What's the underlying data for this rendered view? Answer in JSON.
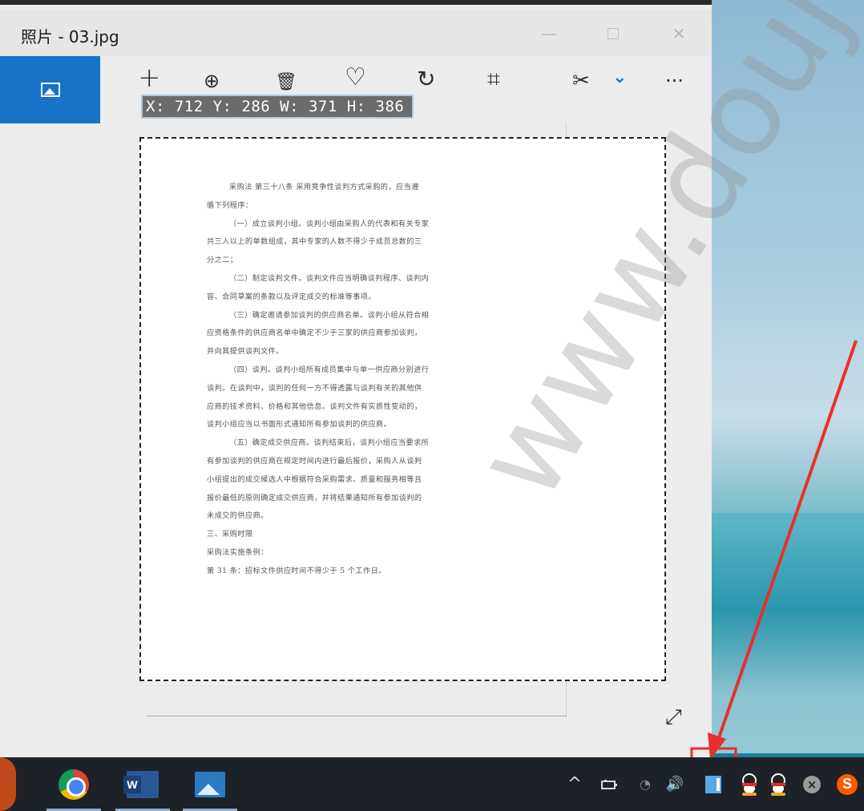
{
  "window": {
    "title": "照片 - 03.jpg",
    "controls": {
      "minimize": "—",
      "close": "✕"
    }
  },
  "toolbar": {
    "add": "+",
    "zoom": "⊕",
    "delete": "🗑",
    "favorite": "♡",
    "rotate": "↻",
    "crop": "⌗",
    "edit": "✂",
    "edit_dropdown": "⌄",
    "more": "···"
  },
  "selection_readout": "X: 712 Y: 286 W: 371 H: 386",
  "document": {
    "lines": [
      {
        "text": "采购法  第三十八条  采用竞争性谈判方式采购的，应当遵",
        "indent": true
      },
      {
        "text": "循下列程序：",
        "indent": false
      },
      {
        "text": "（一）成立谈判小组。谈判小组由采购人的代表和有关专家",
        "indent": true
      },
      {
        "text": "共三人以上的单数组成，其中专家的人数不得少于成员总数的三",
        "indent": false
      },
      {
        "text": "分之二；",
        "indent": false
      },
      {
        "text": "（二）制定谈判文件。谈判文件应当明确谈判程序、谈判内",
        "indent": true
      },
      {
        "text": "容、合同草案的条款以及评定成交的标准等事项。",
        "indent": false
      },
      {
        "text": "（三）确定邀请参加谈判的供应商名单。谈判小组从符合相",
        "indent": true
      },
      {
        "text": "应资格条件的供应商名单中确定不少于三家的供应商参加谈判，",
        "indent": false
      },
      {
        "text": "并向其提供谈判文件。",
        "indent": false
      },
      {
        "text": "（四）谈判。谈判小组所有成员集中与单一供应商分别进行",
        "indent": true
      },
      {
        "text": "谈判。在谈判中，谈判的任何一方不得透露与谈判有关的其他供",
        "indent": false
      },
      {
        "text": "应商的技术资料、价格和其他信息。谈判文件有实质性变动的，",
        "indent": false
      },
      {
        "text": "谈判小组应当以书面形式通知所有参加谈判的供应商。",
        "indent": false
      },
      {
        "text": "（五）确定成交供应商。谈判结束后，谈判小组应当要求所",
        "indent": true
      },
      {
        "text": "有参加谈判的供应商在规定时间内进行最后报价，采购人从谈判",
        "indent": false
      },
      {
        "text": "小组提出的成交候选人中根据符合采购需求、质量和服务相等且",
        "indent": false
      },
      {
        "text": "报价最低的原则确定成交供应商，并将结果通知所有参加谈判的",
        "indent": false
      },
      {
        "text": "未成交的供应商。",
        "indent": false
      },
      {
        "text": "三、采购时限",
        "indent": false
      },
      {
        "text": "采购法实施条例：",
        "indent": false
      },
      {
        "text": "第 31 条：招标文件供应时间不得少于 5 个工作日。",
        "indent": false
      }
    ]
  },
  "expand_icon": "⤢",
  "watermark": "www.doujv.com",
  "taskbar": {
    "apps": [
      {
        "name": "chrome-icon"
      },
      {
        "name": "word-icon"
      },
      {
        "name": "photos-icon"
      }
    ],
    "tray": {
      "chevron": "^",
      "volume": "🔊",
      "wifi": "◔"
    }
  },
  "colors": {
    "accent": "#1673c7",
    "annotation_red": "#e8302d",
    "taskbar": "#1c2227"
  }
}
